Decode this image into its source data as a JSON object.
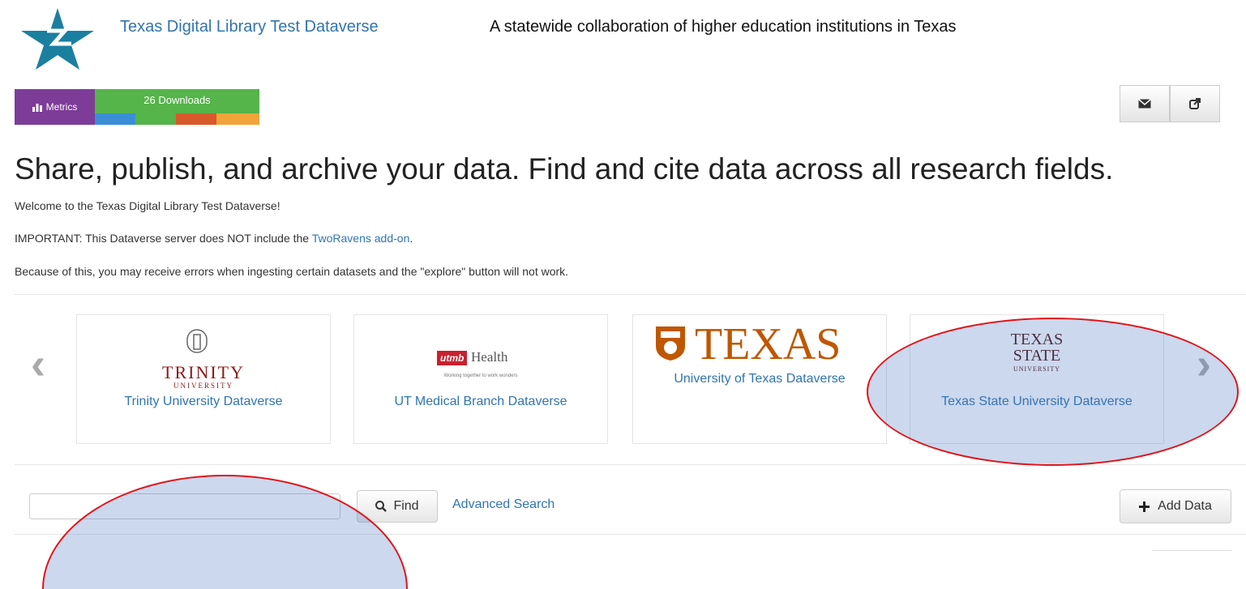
{
  "header": {
    "dataverse_name": "Texas Digital Library Test Dataverse",
    "tagline": "A statewide collaboration of higher education institutions in Texas"
  },
  "metrics": {
    "label": "Metrics",
    "downloads": "26 Downloads",
    "colors": {
      "label_bg": "#7d3c98",
      "bar_bg": "#55b44a"
    }
  },
  "toolbar": {
    "email_icon": "envelope-icon",
    "share_icon": "share-icon"
  },
  "headline": "Share, publish, and archive your data. Find and cite data across all research fields.",
  "welcome": "Welcome to the Texas Digital Library Test Dataverse!",
  "important": {
    "prefix": "IMPORTANT: This Dataverse server does NOT include the ",
    "link": "TwoRavens add-on",
    "suffix": "."
  },
  "notice": "Because of this, you may receive errors when ingesting certain datasets and the \"explore\" button will not work.",
  "carousel": [
    {
      "logo_text": "TRINITY",
      "logo_sub": "UNIVERSITY",
      "label": "Trinity University Dataverse"
    },
    {
      "logo_badge": "utmb",
      "logo_text": "Health",
      "logo_sub": "Working together to work wonders",
      "label": "UT Medical Branch Dataverse"
    },
    {
      "logo_text": "TEXAS",
      "label": "University of Texas Dataverse"
    },
    {
      "logo_text": "TEXAS",
      "logo_text2": "STATE",
      "logo_sub": "UNIVERSITY",
      "label": "Texas State University Dataverse"
    }
  ],
  "search": {
    "placeholder": "",
    "find_label": "Find",
    "advanced_label": "Advanced Search"
  },
  "add_data_label": "Add Data",
  "accent_color": "#3174af"
}
